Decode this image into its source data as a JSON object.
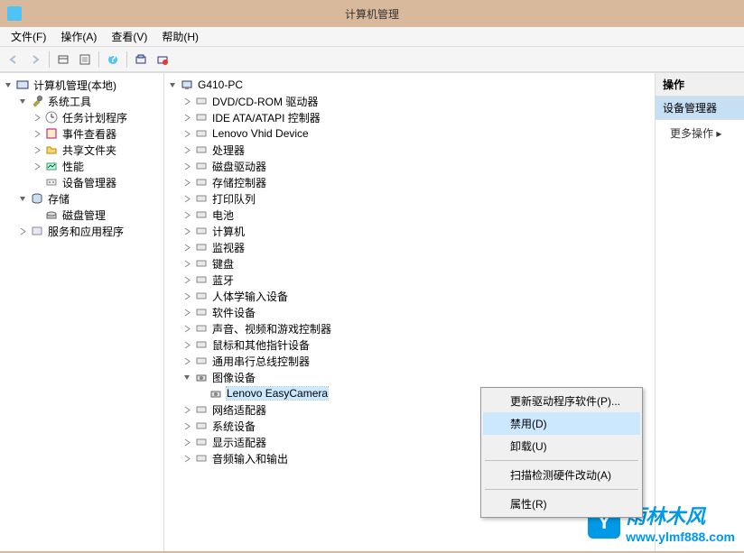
{
  "window": {
    "title": "计算机管理"
  },
  "menubar": [
    "文件(F)",
    "操作(A)",
    "查看(V)",
    "帮助(H)"
  ],
  "leftTree": {
    "root": "计算机管理(本地)",
    "g1": {
      "label": "系统工具",
      "items": [
        "任务计划程序",
        "事件查看器",
        "共享文件夹",
        "性能",
        "设备管理器"
      ]
    },
    "g2": {
      "label": "存储",
      "items": [
        "磁盘管理"
      ]
    },
    "g3": {
      "label": "服务和应用程序"
    }
  },
  "centerTree": {
    "root": "G410-PC",
    "items": [
      "DVD/CD-ROM 驱动器",
      "IDE ATA/ATAPI 控制器",
      "Lenovo Vhid Device",
      "处理器",
      "磁盘驱动器",
      "存储控制器",
      "打印队列",
      "电池",
      "计算机",
      "监视器",
      "键盘",
      "蓝牙",
      "人体学输入设备",
      "软件设备",
      "声音、视频和游戏控制器",
      "鼠标和其他指针设备",
      "通用串行总线控制器"
    ],
    "imgGroup": {
      "label": "图像设备",
      "child": "Lenovo EasyCamera"
    },
    "items2": [
      "网络适配器",
      "系统设备",
      "显示适配器",
      "音频输入和输出"
    ]
  },
  "contextMenu": {
    "i0": "更新驱动程序软件(P)...",
    "i1": "禁用(D)",
    "i2": "卸载(U)",
    "i3": "扫描检测硬件改动(A)",
    "i4": "属性(R)"
  },
  "rightPane": {
    "header": "操作",
    "selected": "设备管理器",
    "more": "更多操作"
  },
  "watermark": {
    "brand": "雨林木风",
    "url": "www.ylmf888.com"
  }
}
